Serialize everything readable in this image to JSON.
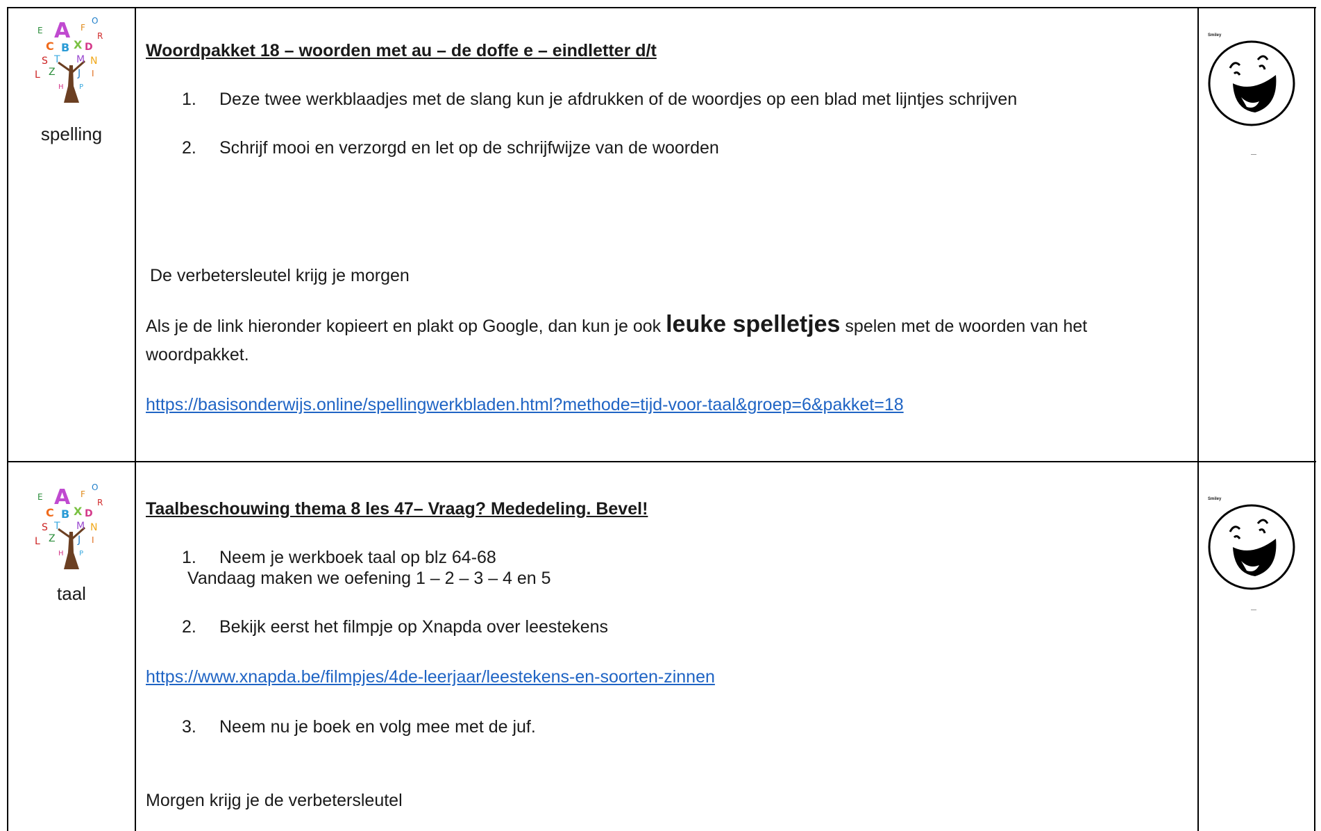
{
  "rows": [
    {
      "subject": "spelling",
      "title": "Woordpakket 18 – woorden met au – de doffe e – eindletter d/t",
      "items": [
        {
          "num": "1.",
          "text": "Deze twee werkblaadjes met de slang kun je afdrukken of de woordjes op een blad met lijntjes schrijven"
        },
        {
          "num": "2.",
          "text": "Schrijf mooi en verzorgd en let op de schrijfwijze van de woorden"
        }
      ],
      "note": "De verbetersleutel krijg je morgen",
      "para_before": "Als je de link hieronder kopieert en plakt op Google, dan  kun je ook ",
      "para_emphasis": "leuke spelletjes",
      "para_after": " spelen met de woorden van het",
      "para_line2": "woordpakket.",
      "link": "https://basisonderwijs.online/spellingwerkbladen.html?methode=tijd-voor-taal&groep=6&pakket=18",
      "smiley_label": "Smiley"
    },
    {
      "subject": "taal",
      "title": "Taalbeschouwing thema 8 les 47– Vraag? Mededeling. Bevel!",
      "items": [
        {
          "num": "1.",
          "text": "Neem je werkboek taal op blz 64-68"
        },
        {
          "num": "2.",
          "text": "Bekijk eerst het filmpje op Xnapda over leestekens"
        },
        {
          "num": "3.",
          "text": "Neem nu je boek en volg mee met de juf."
        }
      ],
      "subline": "Vandaag maken we oefening 1 – 2 – 3 – 4  en 5",
      "link": "https://www.xnapda.be/filmpjes/4de-leerjaar/leestekens-en-soorten-zinnen",
      "note": "Morgen krijg je de verbetersleutel",
      "smiley_label": "Smiley"
    }
  ],
  "icons": {
    "tree": "alphabet-tree-icon",
    "smiley": "laughing-smiley-icon"
  }
}
